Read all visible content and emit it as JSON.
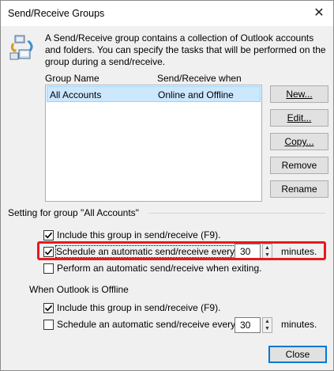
{
  "window": {
    "title": "Send/Receive Groups",
    "close_glyph": "✕"
  },
  "description": "A Send/Receive group contains a collection of Outlook accounts and folders. You can specify the tasks that will be performed on the group during a send/receive.",
  "groups_list": {
    "columns": [
      "Group Name",
      "Send/Receive when"
    ],
    "rows": [
      {
        "name": "All Accounts",
        "when": "Online and Offline",
        "selected": true
      }
    ]
  },
  "side_buttons": {
    "new": "New...",
    "edit": "Edit...",
    "copy": "Copy...",
    "remove": "Remove",
    "rename": "Rename"
  },
  "group_settings": {
    "label": "Setting for group \"All Accounts\"",
    "include": {
      "label": "Include this group in send/receive (F9).",
      "checked": true
    },
    "schedule": {
      "label": "Schedule an automatic send/receive every",
      "checked": true,
      "value": "30",
      "unit": "minutes."
    },
    "exit": {
      "label": "Perform an automatic send/receive when exiting.",
      "checked": false
    }
  },
  "offline_settings": {
    "label": "When Outlook is Offline",
    "include": {
      "label": "Include this group in send/receive (F9).",
      "checked": true
    },
    "schedule": {
      "label": "Schedule an automatic send/receive every",
      "checked": false,
      "value": "30",
      "unit": "minutes."
    }
  },
  "footer": {
    "close": "Close"
  },
  "colors": {
    "highlight": "#e8191d",
    "selection": "#cce8ff",
    "default_button_border": "#0078d7"
  }
}
